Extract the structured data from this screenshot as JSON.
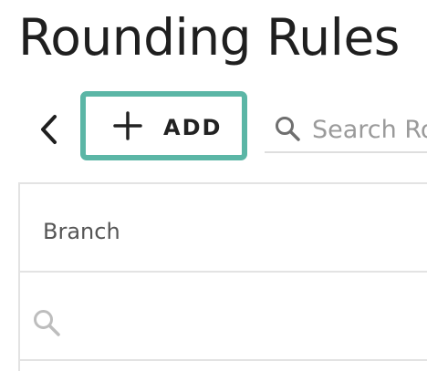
{
  "header": {
    "title": "Rounding Rules"
  },
  "toolbar": {
    "back_icon": "chevron-left-icon",
    "add_icon": "plus-icon",
    "add_label": "ADD",
    "add_accent": "#5bb6a6"
  },
  "search": {
    "icon": "search-icon",
    "placeholder": "Search Rounding Rules"
  },
  "table": {
    "columns": [
      {
        "label": "Branch"
      }
    ],
    "filter_icon": "search-icon"
  }
}
